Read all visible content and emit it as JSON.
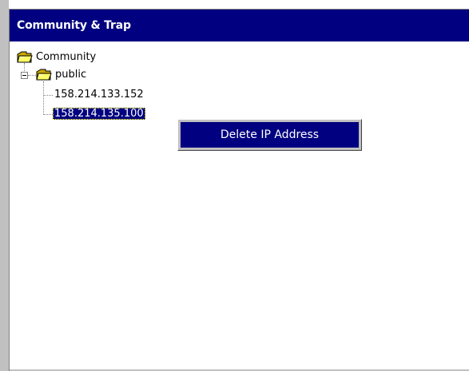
{
  "panel": {
    "title": "Community & Trap"
  },
  "tree": {
    "root": {
      "label": "Community",
      "icon": "folder-icon",
      "children": [
        {
          "label": "public",
          "icon": "folder-icon",
          "expanded": true,
          "children": [
            {
              "label": "158.214.133.152",
              "selected": false
            },
            {
              "label": "158.214.135.100",
              "selected": true
            }
          ]
        }
      ]
    }
  },
  "context_menu": {
    "items": [
      {
        "label": "Delete IP Address",
        "highlighted": true
      }
    ]
  },
  "colors": {
    "header_bg": "#000080",
    "selection_bg": "#000080",
    "menu_bg": "#c0c0c0",
    "frame_gray": "#c0c0c0"
  }
}
